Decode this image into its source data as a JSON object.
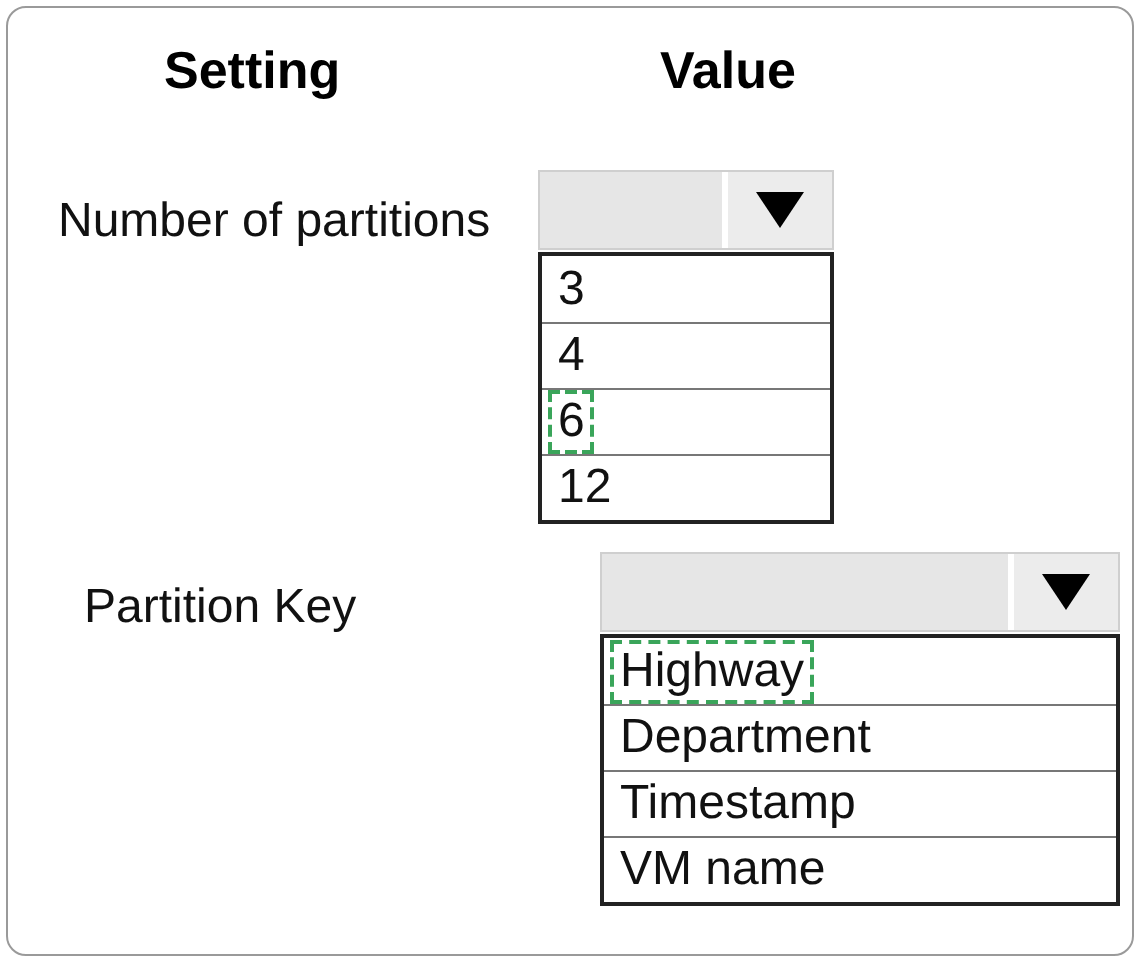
{
  "headers": [
    "Setting",
    "Value"
  ],
  "settings": [
    {
      "label": "Number of partitions",
      "options": [
        {
          "label": "3",
          "selected": false
        },
        {
          "label": "4",
          "selected": false
        },
        {
          "label": "6",
          "selected": true
        },
        {
          "label": "12",
          "selected": false
        }
      ]
    },
    {
      "label": "Partition Key",
      "options": [
        {
          "label": "Highway",
          "selected": true
        },
        {
          "label": "Department",
          "selected": false
        },
        {
          "label": "Timestamp",
          "selected": false
        },
        {
          "label": "VM name",
          "selected": false
        }
      ]
    }
  ]
}
